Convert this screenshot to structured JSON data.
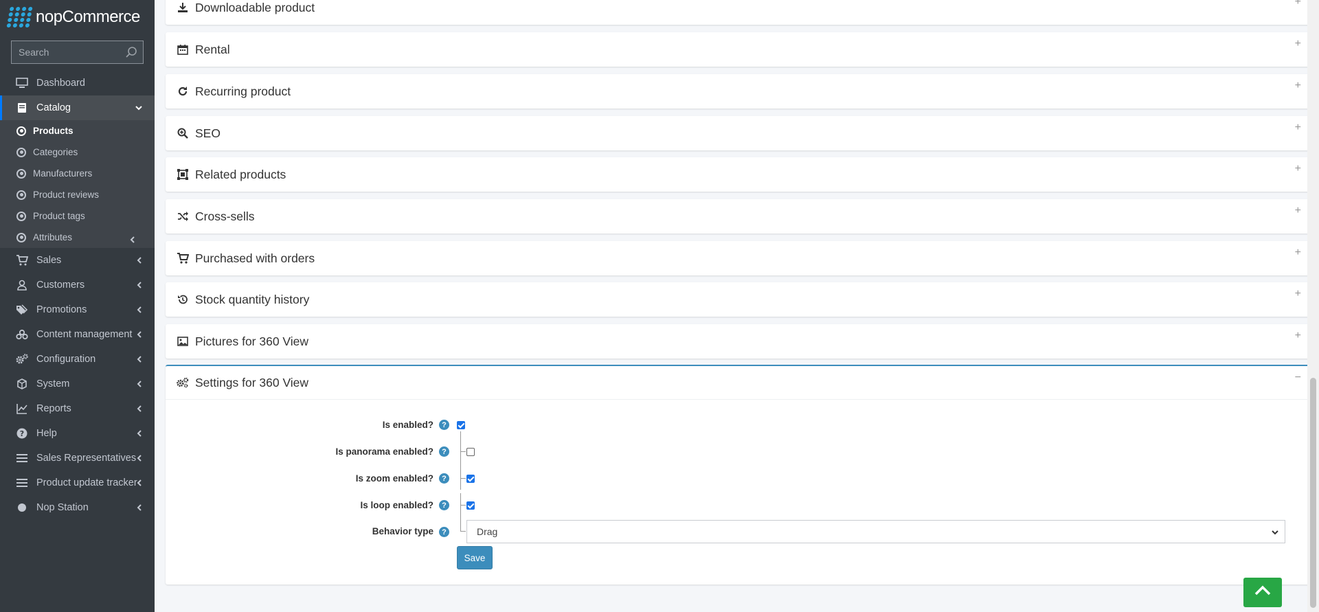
{
  "brand": {
    "name": "nopCommerce"
  },
  "search": {
    "placeholder": "Search"
  },
  "sidebar": {
    "items": [
      {
        "label": "Dashboard"
      },
      {
        "label": "Catalog"
      },
      {
        "label": "Sales"
      },
      {
        "label": "Customers"
      },
      {
        "label": "Promotions"
      },
      {
        "label": "Content management"
      },
      {
        "label": "Configuration"
      },
      {
        "label": "System"
      },
      {
        "label": "Reports"
      },
      {
        "label": "Help"
      },
      {
        "label": "Sales Representatives"
      },
      {
        "label": "Product update tracker"
      },
      {
        "label": "Nop Station"
      }
    ],
    "catalog_sub": [
      {
        "label": "Products"
      },
      {
        "label": "Categories"
      },
      {
        "label": "Manufacturers"
      },
      {
        "label": "Product reviews"
      },
      {
        "label": "Product tags"
      },
      {
        "label": "Attributes"
      }
    ]
  },
  "panels": [
    {
      "title": "Downloadable product",
      "toggle": "+"
    },
    {
      "title": "Rental",
      "toggle": "+"
    },
    {
      "title": "Recurring product",
      "toggle": "+"
    },
    {
      "title": "SEO",
      "toggle": "+"
    },
    {
      "title": "Related products",
      "toggle": "+"
    },
    {
      "title": "Cross-sells",
      "toggle": "+"
    },
    {
      "title": "Purchased with orders",
      "toggle": "+"
    },
    {
      "title": "Stock quantity history",
      "toggle": "+"
    },
    {
      "title": "Pictures for 360 View",
      "toggle": "+"
    },
    {
      "title": "Settings for 360 View",
      "toggle": "−"
    }
  ],
  "settings360": {
    "fields": [
      {
        "label": "Is enabled?",
        "checked": true
      },
      {
        "label": "Is panorama enabled?",
        "checked": false
      },
      {
        "label": "Is zoom enabled?",
        "checked": true
      },
      {
        "label": "Is loop enabled?",
        "checked": true
      }
    ],
    "behavior_label": "Behavior type",
    "behavior_value": "Drag",
    "help_glyph": "?",
    "save_label": "Save"
  },
  "colors": {
    "sidebar_bg": "#343a40",
    "accent": "#3c8dbc",
    "scroll_top_bg": "#28a745",
    "checkbox_on": "#1a73e8"
  }
}
